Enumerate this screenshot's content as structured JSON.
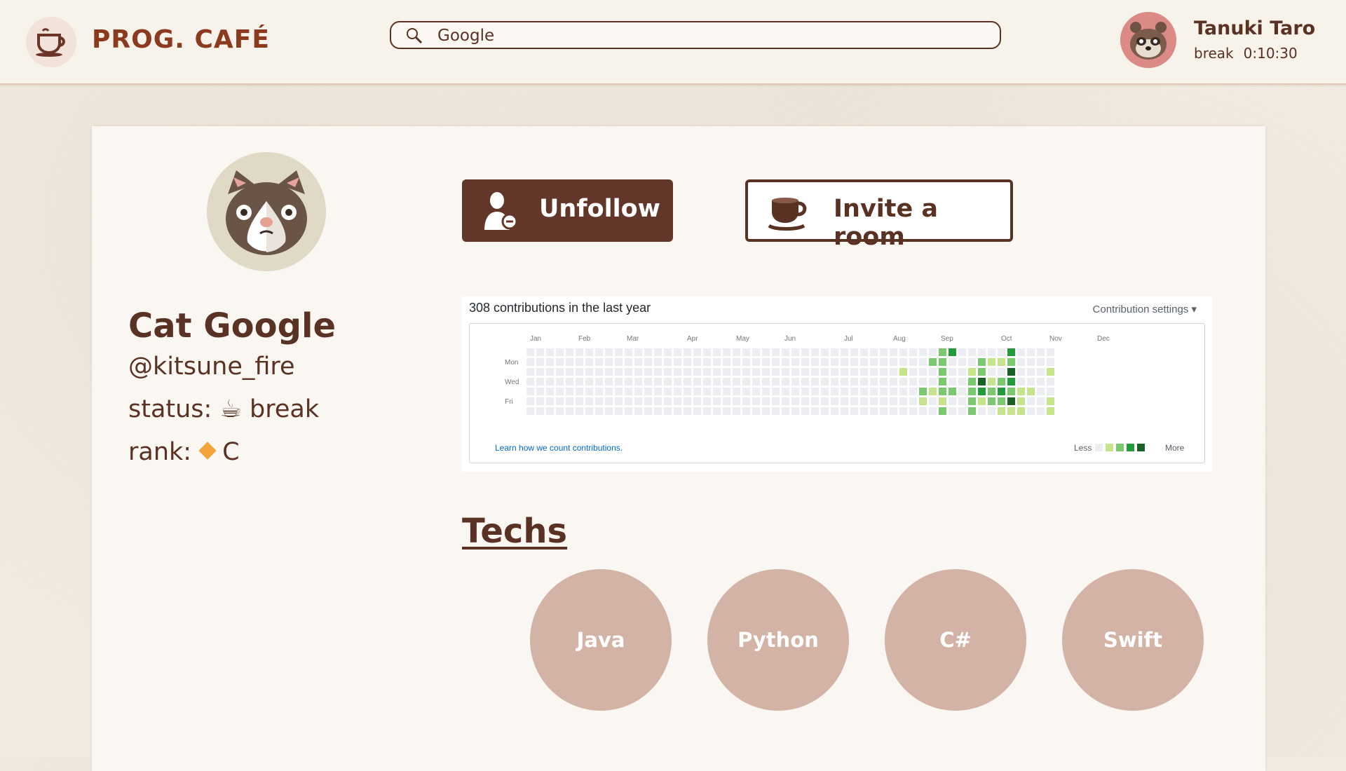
{
  "header": {
    "app_name": "PROG. CAFÉ",
    "logo_icon": "coffee-cup-icon",
    "search": {
      "value": "Google",
      "placeholder": ""
    },
    "user": {
      "name": "Tanuki Taro",
      "status": "break",
      "timer": "0:10:30",
      "avatar_icon": "tanuki-avatar"
    }
  },
  "profile": {
    "display_name": "Cat Google",
    "handle": "@kitsune_fire",
    "status_label": "status:",
    "status_icon": "☕",
    "status_value": "break",
    "rank_label": "rank:",
    "rank_icon": "orange-diamond-icon",
    "rank_value": "C",
    "avatar_icon": "cat-avatar"
  },
  "actions": {
    "unfollow_label": "Unfollow",
    "invite_label": "Invite a room"
  },
  "contributions": {
    "title": "308 contributions in the last year",
    "settings_label": "Contribution settings ▾",
    "months": [
      "Jan",
      "Feb",
      "Mar",
      "Apr",
      "May",
      "Jun",
      "Jul",
      "Aug",
      "Sep",
      "Oct",
      "Nov",
      "Dec"
    ],
    "day_labels": [
      "Mon",
      "Wed",
      "Fri"
    ],
    "learn_link": "Learn how we count contributions.",
    "legend_less": "Less",
    "legend_more": "More",
    "colors": [
      "#ebedf0",
      "#c6e48b",
      "#7bc96f",
      "#239a3b",
      "#196127"
    ],
    "active_cells": [
      [
        42,
        0,
        2
      ],
      [
        43,
        0,
        3
      ],
      [
        49,
        0,
        3
      ],
      [
        41,
        1,
        2
      ],
      [
        42,
        1,
        2
      ],
      [
        46,
        1,
        2
      ],
      [
        47,
        1,
        1
      ],
      [
        48,
        1,
        1
      ],
      [
        49,
        1,
        2
      ],
      [
        38,
        2,
        1
      ],
      [
        42,
        2,
        2
      ],
      [
        45,
        2,
        1
      ],
      [
        46,
        2,
        2
      ],
      [
        49,
        2,
        4
      ],
      [
        53,
        2,
        1
      ],
      [
        42,
        3,
        2
      ],
      [
        45,
        3,
        2
      ],
      [
        46,
        3,
        4
      ],
      [
        47,
        3,
        1
      ],
      [
        48,
        3,
        2
      ],
      [
        49,
        3,
        3
      ],
      [
        40,
        4,
        2
      ],
      [
        41,
        4,
        1
      ],
      [
        42,
        4,
        2
      ],
      [
        43,
        4,
        2
      ],
      [
        45,
        4,
        2
      ],
      [
        46,
        4,
        3
      ],
      [
        47,
        4,
        2
      ],
      [
        48,
        4,
        3
      ],
      [
        49,
        4,
        2
      ],
      [
        50,
        4,
        1
      ],
      [
        51,
        4,
        1
      ],
      [
        40,
        5,
        1
      ],
      [
        42,
        5,
        1
      ],
      [
        45,
        5,
        2
      ],
      [
        46,
        5,
        1
      ],
      [
        47,
        5,
        2
      ],
      [
        48,
        5,
        2
      ],
      [
        49,
        5,
        4
      ],
      [
        50,
        5,
        1
      ],
      [
        53,
        5,
        1
      ],
      [
        42,
        6,
        2
      ],
      [
        45,
        6,
        2
      ],
      [
        48,
        6,
        1
      ],
      [
        49,
        6,
        1
      ],
      [
        50,
        6,
        1
      ],
      [
        53,
        6,
        1
      ]
    ]
  },
  "techs": {
    "title": "Techs",
    "items": [
      "Java",
      "Python",
      "C#",
      "Swift"
    ]
  }
}
